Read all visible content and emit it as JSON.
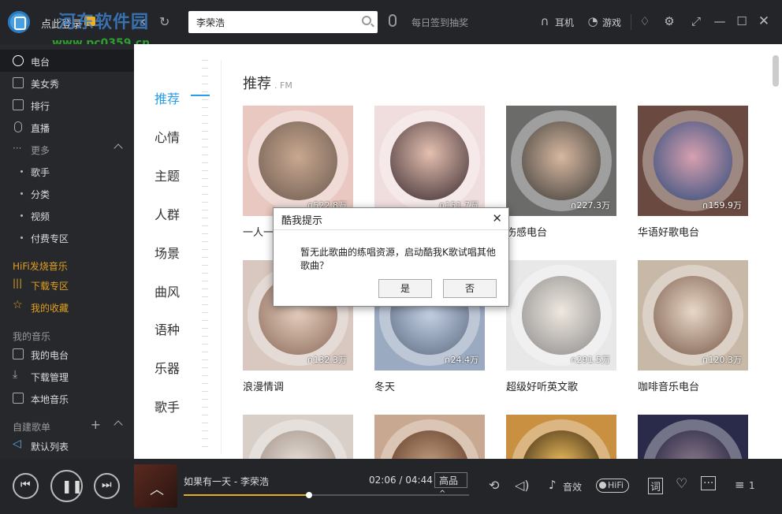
{
  "header": {
    "login": "点此登录",
    "watermark": "河东软件园",
    "watermark_url": "www.pc0359.cn",
    "search_value": "李荣浩",
    "daily": "每日签到抽奖",
    "earphone": "耳机",
    "game": "游戏"
  },
  "sidebar": {
    "items": [
      {
        "label": "电台"
      },
      {
        "label": "美女秀"
      },
      {
        "label": "排行"
      },
      {
        "label": "直播"
      },
      {
        "label": "更多"
      },
      {
        "label": "歌手"
      },
      {
        "label": "分类"
      },
      {
        "label": "视频"
      },
      {
        "label": "付费专区"
      }
    ],
    "hifi_section": "HiFi发烧音乐",
    "download_zone": "下载专区",
    "favorites": "我的收藏",
    "my_music_section": "我的音乐",
    "my_radio": "我的电台",
    "download_mgmt": "下载管理",
    "local_music": "本地音乐",
    "playlist_section": "自建歌单",
    "default_list": "默认列表"
  },
  "categories": [
    "推荐",
    "心情",
    "主题",
    "人群",
    "场景",
    "曲风",
    "语种",
    "乐器",
    "歌手"
  ],
  "section": {
    "title": "推荐",
    "subtitle": ". FM"
  },
  "cards": [
    {
      "title": "一人一",
      "count": "522.8万"
    },
    {
      "title": "",
      "count": "151.7万"
    },
    {
      "title": "伤感电台",
      "count": "227.3万"
    },
    {
      "title": "华语好歌电台",
      "count": "159.9万"
    },
    {
      "title": "浪漫情调",
      "count": "132.3万"
    },
    {
      "title": "冬天",
      "count": "24.4万"
    },
    {
      "title": "超级好听英文歌",
      "count": "291.5万"
    },
    {
      "title": "咖啡音乐电台",
      "count": "120.3万"
    },
    {
      "title": "",
      "count": ""
    },
    {
      "title": "",
      "count": ""
    },
    {
      "title": "",
      "count": ""
    },
    {
      "title": "",
      "count": ""
    }
  ],
  "dialog": {
    "title": "酷我提示",
    "message": "暂无此歌曲的练唱资源，启动酷我K歌试唱其他歌曲？",
    "yes": "是",
    "no": "否"
  },
  "player": {
    "song": "如果有一天 - 李荣浩",
    "current": "02:06",
    "total": "04:44",
    "time_sep": " / ",
    "quality": "高品",
    "sound_effect": "音效",
    "hifi": "HiFi",
    "lyrics": "词",
    "queue_count": "1",
    "progress": 0.44
  },
  "colors": {
    "accent": "#2a9de8",
    "gold": "#e0a020",
    "progress": "#e0b020"
  }
}
